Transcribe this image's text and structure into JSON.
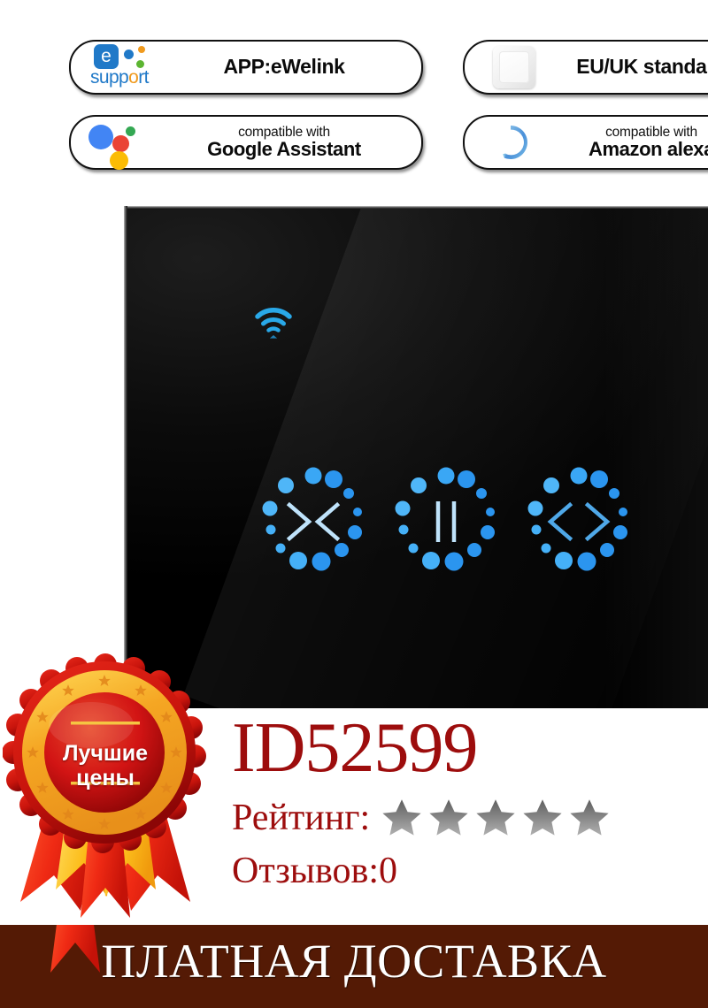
{
  "badges": [
    {
      "id": "ewelink",
      "logo": "ewelink-support-logo",
      "line_small": "",
      "line_big": "",
      "line_single": "APP:eWelink",
      "logo_word": "supp",
      "logo_word_o": "o",
      "logo_word_end": "rt",
      "logo_letter": "e"
    },
    {
      "id": "google-assistant",
      "logo": "google-assistant-logo",
      "line_small": "compatible with",
      "line_big": "Google Assistant",
      "line_single": ""
    },
    {
      "id": "eu-uk-standard",
      "logo": "wall-switch-icon",
      "line_small": "",
      "line_big": "",
      "line_single": "EU/UK standard"
    },
    {
      "id": "amazon-alexa",
      "logo": "amazon-alexa-logo",
      "line_small": "compatible with",
      "line_big": "Amazon alexa",
      "line_single": ""
    }
  ],
  "switch_panel": {
    "wifi_indicator": "wifi-icon",
    "buttons": [
      {
        "id": "close",
        "glyph": "curtain-close-icon",
        "dots": 12
      },
      {
        "id": "pause",
        "glyph": "curtain-pause-icon",
        "dots": 12
      },
      {
        "id": "open",
        "glyph": "curtain-open-icon",
        "dots": 12
      }
    ],
    "accent_color": "#2196f3",
    "panel_color": "#000000"
  },
  "product_info": {
    "id_text": "ID52599",
    "rating_label": "Рейтинг:",
    "rating_stars": 5,
    "star_color": "#787878",
    "reviews_text": "Отзывов:0",
    "text_color": "#9d0d0d"
  },
  "award_badge": {
    "label_top": "Лучшие",
    "label_bottom": "цены",
    "ring_color": "#f5a623",
    "center_color": "#cf1010",
    "ribbon_color": "#e8301c"
  },
  "delivery_banner": {
    "text": "ПЛАТНАЯ ДОСТАВКА",
    "background": "#541a05",
    "text_color": "#ffffff"
  }
}
